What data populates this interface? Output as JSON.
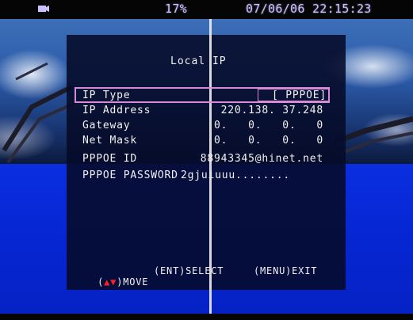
{
  "status": {
    "battery_percent": "17%",
    "datetime": "07/06/06 22:15:23"
  },
  "menu": {
    "title": "Local IP",
    "rows": [
      {
        "label": "IP Type",
        "value": "[ PPPOE]"
      },
      {
        "label": "IP Address",
        "value": "220.138. 37.248"
      },
      {
        "label": "Gateway",
        "value": "0.   0.   0.   0"
      },
      {
        "label": "Net Mask",
        "value": "0.   0.   0.   0"
      },
      {
        "label": "PPPOE ID",
        "value": "88943345@hinet.net"
      },
      {
        "label": "PPPOE PASSWORD",
        "value": "2gjuiuuu........"
      }
    ],
    "footer": {
      "move": ")MOVE",
      "select": "(ENT)SELECT",
      "exit": "(MENU)EXIT"
    }
  },
  "colors": {
    "selection_border": "#d78bd6",
    "arrow_up": "#ff2020",
    "arrow_down": "#ff2020"
  }
}
